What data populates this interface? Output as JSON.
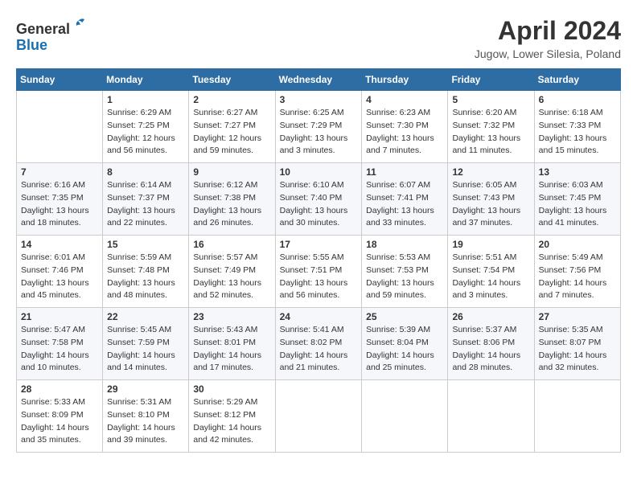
{
  "app": {
    "name_general": "General",
    "name_blue": "Blue"
  },
  "header": {
    "title": "April 2024",
    "location": "Jugow, Lower Silesia, Poland"
  },
  "calendar": {
    "days_of_week": [
      "Sunday",
      "Monday",
      "Tuesday",
      "Wednesday",
      "Thursday",
      "Friday",
      "Saturday"
    ],
    "weeks": [
      [
        {
          "day": "",
          "info": ""
        },
        {
          "day": "1",
          "info": "Sunrise: 6:29 AM\nSunset: 7:25 PM\nDaylight: 12 hours\nand 56 minutes."
        },
        {
          "day": "2",
          "info": "Sunrise: 6:27 AM\nSunset: 7:27 PM\nDaylight: 12 hours\nand 59 minutes."
        },
        {
          "day": "3",
          "info": "Sunrise: 6:25 AM\nSunset: 7:29 PM\nDaylight: 13 hours\nand 3 minutes."
        },
        {
          "day": "4",
          "info": "Sunrise: 6:23 AM\nSunset: 7:30 PM\nDaylight: 13 hours\nand 7 minutes."
        },
        {
          "day": "5",
          "info": "Sunrise: 6:20 AM\nSunset: 7:32 PM\nDaylight: 13 hours\nand 11 minutes."
        },
        {
          "day": "6",
          "info": "Sunrise: 6:18 AM\nSunset: 7:33 PM\nDaylight: 13 hours\nand 15 minutes."
        }
      ],
      [
        {
          "day": "7",
          "info": "Sunrise: 6:16 AM\nSunset: 7:35 PM\nDaylight: 13 hours\nand 18 minutes."
        },
        {
          "day": "8",
          "info": "Sunrise: 6:14 AM\nSunset: 7:37 PM\nDaylight: 13 hours\nand 22 minutes."
        },
        {
          "day": "9",
          "info": "Sunrise: 6:12 AM\nSunset: 7:38 PM\nDaylight: 13 hours\nand 26 minutes."
        },
        {
          "day": "10",
          "info": "Sunrise: 6:10 AM\nSunset: 7:40 PM\nDaylight: 13 hours\nand 30 minutes."
        },
        {
          "day": "11",
          "info": "Sunrise: 6:07 AM\nSunset: 7:41 PM\nDaylight: 13 hours\nand 33 minutes."
        },
        {
          "day": "12",
          "info": "Sunrise: 6:05 AM\nSunset: 7:43 PM\nDaylight: 13 hours\nand 37 minutes."
        },
        {
          "day": "13",
          "info": "Sunrise: 6:03 AM\nSunset: 7:45 PM\nDaylight: 13 hours\nand 41 minutes."
        }
      ],
      [
        {
          "day": "14",
          "info": "Sunrise: 6:01 AM\nSunset: 7:46 PM\nDaylight: 13 hours\nand 45 minutes."
        },
        {
          "day": "15",
          "info": "Sunrise: 5:59 AM\nSunset: 7:48 PM\nDaylight: 13 hours\nand 48 minutes."
        },
        {
          "day": "16",
          "info": "Sunrise: 5:57 AM\nSunset: 7:49 PM\nDaylight: 13 hours\nand 52 minutes."
        },
        {
          "day": "17",
          "info": "Sunrise: 5:55 AM\nSunset: 7:51 PM\nDaylight: 13 hours\nand 56 minutes."
        },
        {
          "day": "18",
          "info": "Sunrise: 5:53 AM\nSunset: 7:53 PM\nDaylight: 13 hours\nand 59 minutes."
        },
        {
          "day": "19",
          "info": "Sunrise: 5:51 AM\nSunset: 7:54 PM\nDaylight: 14 hours\nand 3 minutes."
        },
        {
          "day": "20",
          "info": "Sunrise: 5:49 AM\nSunset: 7:56 PM\nDaylight: 14 hours\nand 7 minutes."
        }
      ],
      [
        {
          "day": "21",
          "info": "Sunrise: 5:47 AM\nSunset: 7:58 PM\nDaylight: 14 hours\nand 10 minutes."
        },
        {
          "day": "22",
          "info": "Sunrise: 5:45 AM\nSunset: 7:59 PM\nDaylight: 14 hours\nand 14 minutes."
        },
        {
          "day": "23",
          "info": "Sunrise: 5:43 AM\nSunset: 8:01 PM\nDaylight: 14 hours\nand 17 minutes."
        },
        {
          "day": "24",
          "info": "Sunrise: 5:41 AM\nSunset: 8:02 PM\nDaylight: 14 hours\nand 21 minutes."
        },
        {
          "day": "25",
          "info": "Sunrise: 5:39 AM\nSunset: 8:04 PM\nDaylight: 14 hours\nand 25 minutes."
        },
        {
          "day": "26",
          "info": "Sunrise: 5:37 AM\nSunset: 8:06 PM\nDaylight: 14 hours\nand 28 minutes."
        },
        {
          "day": "27",
          "info": "Sunrise: 5:35 AM\nSunset: 8:07 PM\nDaylight: 14 hours\nand 32 minutes."
        }
      ],
      [
        {
          "day": "28",
          "info": "Sunrise: 5:33 AM\nSunset: 8:09 PM\nDaylight: 14 hours\nand 35 minutes."
        },
        {
          "day": "29",
          "info": "Sunrise: 5:31 AM\nSunset: 8:10 PM\nDaylight: 14 hours\nand 39 minutes."
        },
        {
          "day": "30",
          "info": "Sunrise: 5:29 AM\nSunset: 8:12 PM\nDaylight: 14 hours\nand 42 minutes."
        },
        {
          "day": "",
          "info": ""
        },
        {
          "day": "",
          "info": ""
        },
        {
          "day": "",
          "info": ""
        },
        {
          "day": "",
          "info": ""
        }
      ]
    ]
  }
}
